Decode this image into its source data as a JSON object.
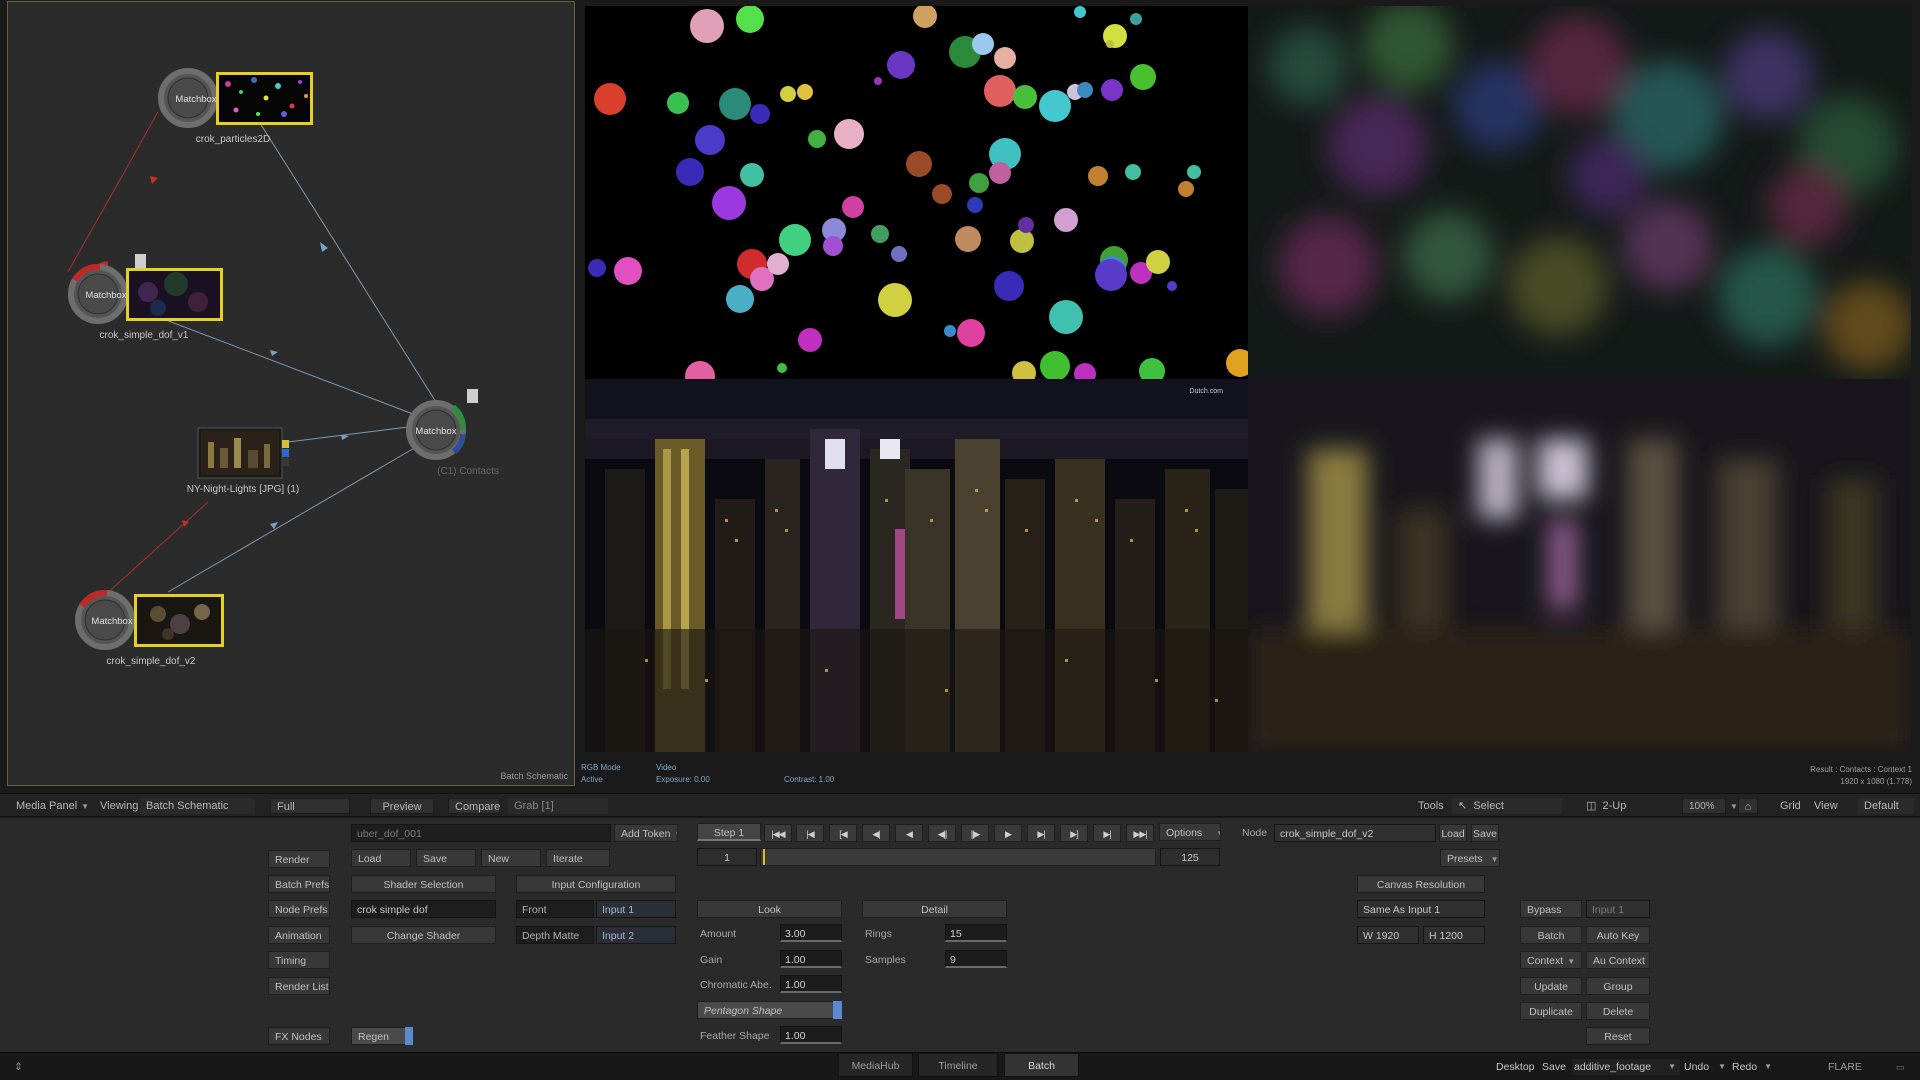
{
  "schematic": {
    "caption": "Batch Schematic",
    "nodes": [
      {
        "badge": "Matchbox",
        "label": "crok_particles2D"
      },
      {
        "badge": "Matchbox",
        "label": "crok_simple_dof_v1"
      },
      {
        "badge": "Matchbox",
        "label": "(C1) Contacts"
      },
      {
        "badge": "",
        "label": "NY-Night-Lights [JPG] (1)"
      },
      {
        "badge": "Matchbox",
        "label": "crok_simple_dof_v2"
      }
    ]
  },
  "viewer": {
    "watermark": "Dutch.com",
    "info_left": {
      "mode": "RGB Mode",
      "state": "Active",
      "video": "Video",
      "exposure": "Exposure: 0.00",
      "contrast": "Contrast: 1.00"
    },
    "info_right": {
      "result": "Result : Contacts : Context 1",
      "resolution": "1920 x 1080 (1.778)"
    }
  },
  "navbar": {
    "media_panel": "Media Panel",
    "viewing_label": "Viewing",
    "viewing_value": "Batch Schematic",
    "full_resolution": "Full Resolution",
    "preview": "Preview",
    "compare": "Compare",
    "grab": "Grab [1]",
    "tools": "Tools",
    "select": "Select",
    "layout": "2-Up",
    "zoom": "100%",
    "grid": "Grid",
    "view": "View",
    "view_value": "Default"
  },
  "panel": {
    "left_buttons": [
      "Render",
      "Batch Prefs",
      "Node Prefs",
      "Animation",
      "Timing",
      "Render List",
      "FX Nodes"
    ],
    "setup_name": "uber_dof_001",
    "add_token": "Add Token",
    "load": "Load",
    "save": "Save",
    "new": "New",
    "iterate": "Iterate",
    "shader_selection": "Shader Selection",
    "shader_name": "crok simple dof",
    "change_shader": "Change Shader",
    "regen": "Regen",
    "input_configuration": "Input Configuration",
    "inputs": [
      {
        "name": "Front",
        "value": "Input 1"
      },
      {
        "name": "Depth Matte",
        "value": "Input 2"
      }
    ],
    "step": "Step 1",
    "transport": [
      "|◀◀",
      "|◀",
      "[◀",
      "◀|",
      "◀",
      "◀||",
      "||▶",
      "▶",
      "▶|",
      "▶]",
      "▶|",
      "▶▶|"
    ],
    "frame_start": "1",
    "frame_end": "125",
    "options": "Options",
    "look_tab": "Look",
    "detail_tab": "Detail",
    "look_params": [
      {
        "label": "Amount",
        "value": "3.00"
      },
      {
        "label": "Gain",
        "value": "1.00"
      },
      {
        "label": "Chromatic Abe.",
        "value": "1.00"
      }
    ],
    "pentagon_shape": "Pentagon Shape",
    "feather_shape": {
      "label": "Feather Shape",
      "value": "1.00"
    },
    "detail_params": [
      {
        "label": "Rings",
        "value": "15"
      },
      {
        "label": "Samples",
        "value": "9"
      }
    ],
    "node_label": "Node",
    "node_name": "crok_simple_dof_v2",
    "node_load": "Load",
    "node_save": "Save",
    "presets": "Presets",
    "canvas_resolution": "Canvas Resolution",
    "same_as_input": "Same As Input 1",
    "width": "W 1920",
    "height": "H 1200",
    "right_buttons": {
      "bypass": "Bypass",
      "bypass_input": "Input 1",
      "batch": "Batch",
      "auto_key": "Auto Key",
      "context": "Context",
      "au_context": "Au Context",
      "update": "Update",
      "group": "Group",
      "duplicate": "Duplicate",
      "delete": "Delete",
      "reset": "Reset"
    }
  },
  "statusbar": {
    "tabs": [
      "MediaHub",
      "Timeline",
      "Batch"
    ],
    "active_tab": "Batch",
    "desktop": "Desktop",
    "save": "Save",
    "project": "additive_footage",
    "undo": "Undo",
    "redo": "Redo",
    "app": "FLARE"
  }
}
